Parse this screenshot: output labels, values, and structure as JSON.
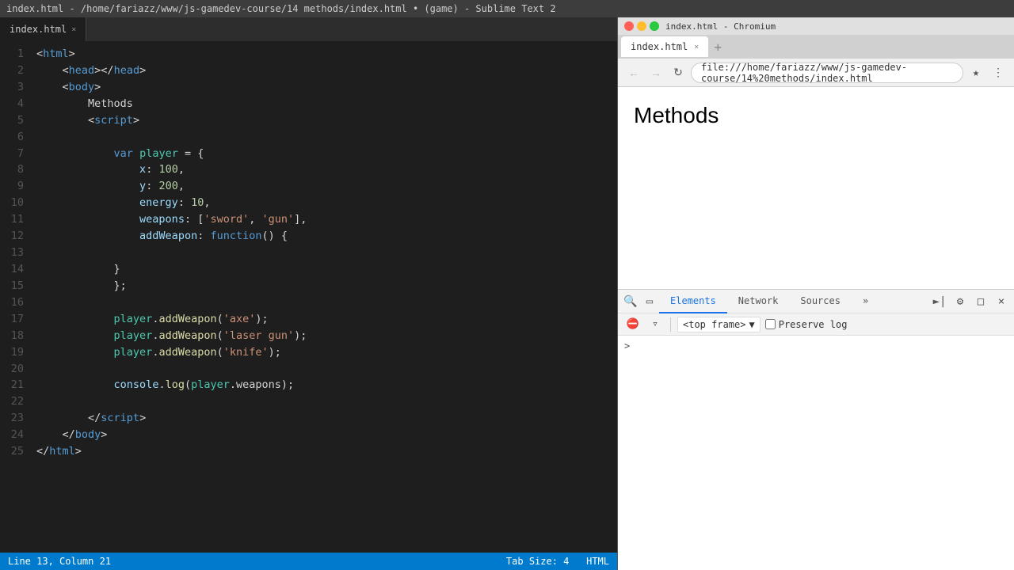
{
  "title_bar": {
    "text": "index.html - /home/fariazz/www/js-gamedev-course/14 methods/index.html • (game) - Sublime Text 2"
  },
  "editor": {
    "tab_name": "index.html",
    "status_left": "Line 13, Column 21",
    "status_right_tab": "Tab Size: 4",
    "status_right_syntax": "HTML",
    "lines": [
      {
        "num": 1,
        "tokens": [
          {
            "t": "<",
            "c": "punct"
          },
          {
            "t": "html",
            "c": "tag"
          },
          {
            "t": ">",
            "c": "punct"
          }
        ]
      },
      {
        "num": 2,
        "tokens": [
          {
            "t": "    ",
            "c": ""
          },
          {
            "t": "<",
            "c": "punct"
          },
          {
            "t": "head",
            "c": "tag"
          },
          {
            "t": "></",
            "c": "punct"
          },
          {
            "t": "head",
            "c": "tag"
          },
          {
            "t": ">",
            "c": "punct"
          }
        ]
      },
      {
        "num": 3,
        "tokens": [
          {
            "t": "    ",
            "c": ""
          },
          {
            "t": "<",
            "c": "punct"
          },
          {
            "t": "body",
            "c": "tag"
          },
          {
            "t": ">",
            "c": "punct"
          }
        ]
      },
      {
        "num": 4,
        "tokens": [
          {
            "t": "        Methods",
            "c": ""
          }
        ]
      },
      {
        "num": 5,
        "tokens": [
          {
            "t": "        ",
            "c": ""
          },
          {
            "t": "<",
            "c": "punct"
          },
          {
            "t": "script",
            "c": "tag"
          },
          {
            "t": ">",
            "c": "punct"
          }
        ]
      },
      {
        "num": 6,
        "tokens": []
      },
      {
        "num": 7,
        "tokens": [
          {
            "t": "            ",
            "c": ""
          },
          {
            "t": "var",
            "c": "kw"
          },
          {
            "t": " ",
            "c": ""
          },
          {
            "t": "player",
            "c": "obj"
          },
          {
            "t": " = {",
            "c": ""
          }
        ]
      },
      {
        "num": 8,
        "tokens": [
          {
            "t": "                ",
            "c": ""
          },
          {
            "t": "x",
            "c": "prop"
          },
          {
            "t": ": ",
            "c": ""
          },
          {
            "t": "100",
            "c": "num"
          },
          {
            "t": ",",
            "c": ""
          }
        ]
      },
      {
        "num": 9,
        "tokens": [
          {
            "t": "                ",
            "c": ""
          },
          {
            "t": "y",
            "c": "prop"
          },
          {
            "t": ": ",
            "c": ""
          },
          {
            "t": "200",
            "c": "num"
          },
          {
            "t": ",",
            "c": ""
          }
        ]
      },
      {
        "num": 10,
        "tokens": [
          {
            "t": "                ",
            "c": ""
          },
          {
            "t": "energy",
            "c": "prop"
          },
          {
            "t": ": ",
            "c": ""
          },
          {
            "t": "10",
            "c": "num"
          },
          {
            "t": ",",
            "c": ""
          }
        ]
      },
      {
        "num": 11,
        "tokens": [
          {
            "t": "                ",
            "c": ""
          },
          {
            "t": "weapons",
            "c": "prop"
          },
          {
            "t": ": [",
            "c": ""
          },
          {
            "t": "'sword'",
            "c": "str"
          },
          {
            "t": ", ",
            "c": ""
          },
          {
            "t": "'gun'",
            "c": "str"
          },
          {
            "t": "],",
            "c": ""
          }
        ]
      },
      {
        "num": 12,
        "tokens": [
          {
            "t": "                ",
            "c": ""
          },
          {
            "t": "addWeapon",
            "c": "prop"
          },
          {
            "t": ": ",
            "c": ""
          },
          {
            "t": "function",
            "c": "kw"
          },
          {
            "t": "() {",
            "c": ""
          }
        ]
      },
      {
        "num": 13,
        "tokens": []
      },
      {
        "num": 14,
        "tokens": [
          {
            "t": "            }",
            "c": ""
          }
        ]
      },
      {
        "num": 15,
        "tokens": [
          {
            "t": "            };",
            "c": ""
          }
        ]
      },
      {
        "num": 16,
        "tokens": []
      },
      {
        "num": 17,
        "tokens": [
          {
            "t": "            ",
            "c": ""
          },
          {
            "t": "player",
            "c": "obj"
          },
          {
            "t": ".",
            "c": ""
          },
          {
            "t": "addWeapon",
            "c": "fn"
          },
          {
            "t": "(",
            "c": ""
          },
          {
            "t": "'axe'",
            "c": "str"
          },
          {
            "t": ");",
            "c": ""
          }
        ]
      },
      {
        "num": 18,
        "tokens": [
          {
            "t": "            ",
            "c": ""
          },
          {
            "t": "player",
            "c": "obj"
          },
          {
            "t": ".",
            "c": ""
          },
          {
            "t": "addWeapon",
            "c": "fn"
          },
          {
            "t": "(",
            "c": ""
          },
          {
            "t": "'laser gun'",
            "c": "str"
          },
          {
            "t": ");",
            "c": ""
          }
        ]
      },
      {
        "num": 19,
        "tokens": [
          {
            "t": "            ",
            "c": ""
          },
          {
            "t": "player",
            "c": "obj"
          },
          {
            "t": ".",
            "c": ""
          },
          {
            "t": "addWeapon",
            "c": "fn"
          },
          {
            "t": "(",
            "c": ""
          },
          {
            "t": "'knife'",
            "c": "str"
          },
          {
            "t": ");",
            "c": ""
          }
        ]
      },
      {
        "num": 20,
        "tokens": []
      },
      {
        "num": 21,
        "tokens": [
          {
            "t": "            ",
            "c": ""
          },
          {
            "t": "console",
            "c": "console-obj"
          },
          {
            "t": ".",
            "c": ""
          },
          {
            "t": "log",
            "c": "fn"
          },
          {
            "t": "(",
            "c": ""
          },
          {
            "t": "player",
            "c": "obj"
          },
          {
            "t": ".weapons);",
            "c": ""
          }
        ]
      },
      {
        "num": 22,
        "tokens": []
      },
      {
        "num": 23,
        "tokens": [
          {
            "t": "        ",
            "c": ""
          },
          {
            "t": "</",
            "c": "punct"
          },
          {
            "t": "script",
            "c": "tag"
          },
          {
            "t": ">",
            "c": "punct"
          }
        ]
      },
      {
        "num": 24,
        "tokens": [
          {
            "t": "    ",
            "c": ""
          },
          {
            "t": "</",
            "c": "punct"
          },
          {
            "t": "body",
            "c": "tag"
          },
          {
            "t": ">",
            "c": "punct"
          }
        ]
      },
      {
        "num": 25,
        "tokens": [
          {
            "t": "</",
            "c": "punct"
          },
          {
            "t": "html",
            "c": "tag"
          },
          {
            "t": ">",
            "c": "punct"
          }
        ]
      }
    ]
  },
  "browser": {
    "title": "index.html - Chromium",
    "tab_name": "index.html",
    "url": "file:///home/fariazz/www/js-gamedev-course/14%20methods/index.html",
    "page_heading": "Methods"
  },
  "devtools": {
    "tabs": [
      "Elements",
      "Network",
      "Sources"
    ],
    "more_tabs_label": "»",
    "active_tab": "Elements",
    "frame_selector": "<top frame>",
    "preserve_log": "Preserve log",
    "close_label": "×"
  },
  "status_bar": {
    "left": "Line 13, Column 21",
    "tab_size": "Tab Size: 4",
    "syntax": "HTML"
  }
}
